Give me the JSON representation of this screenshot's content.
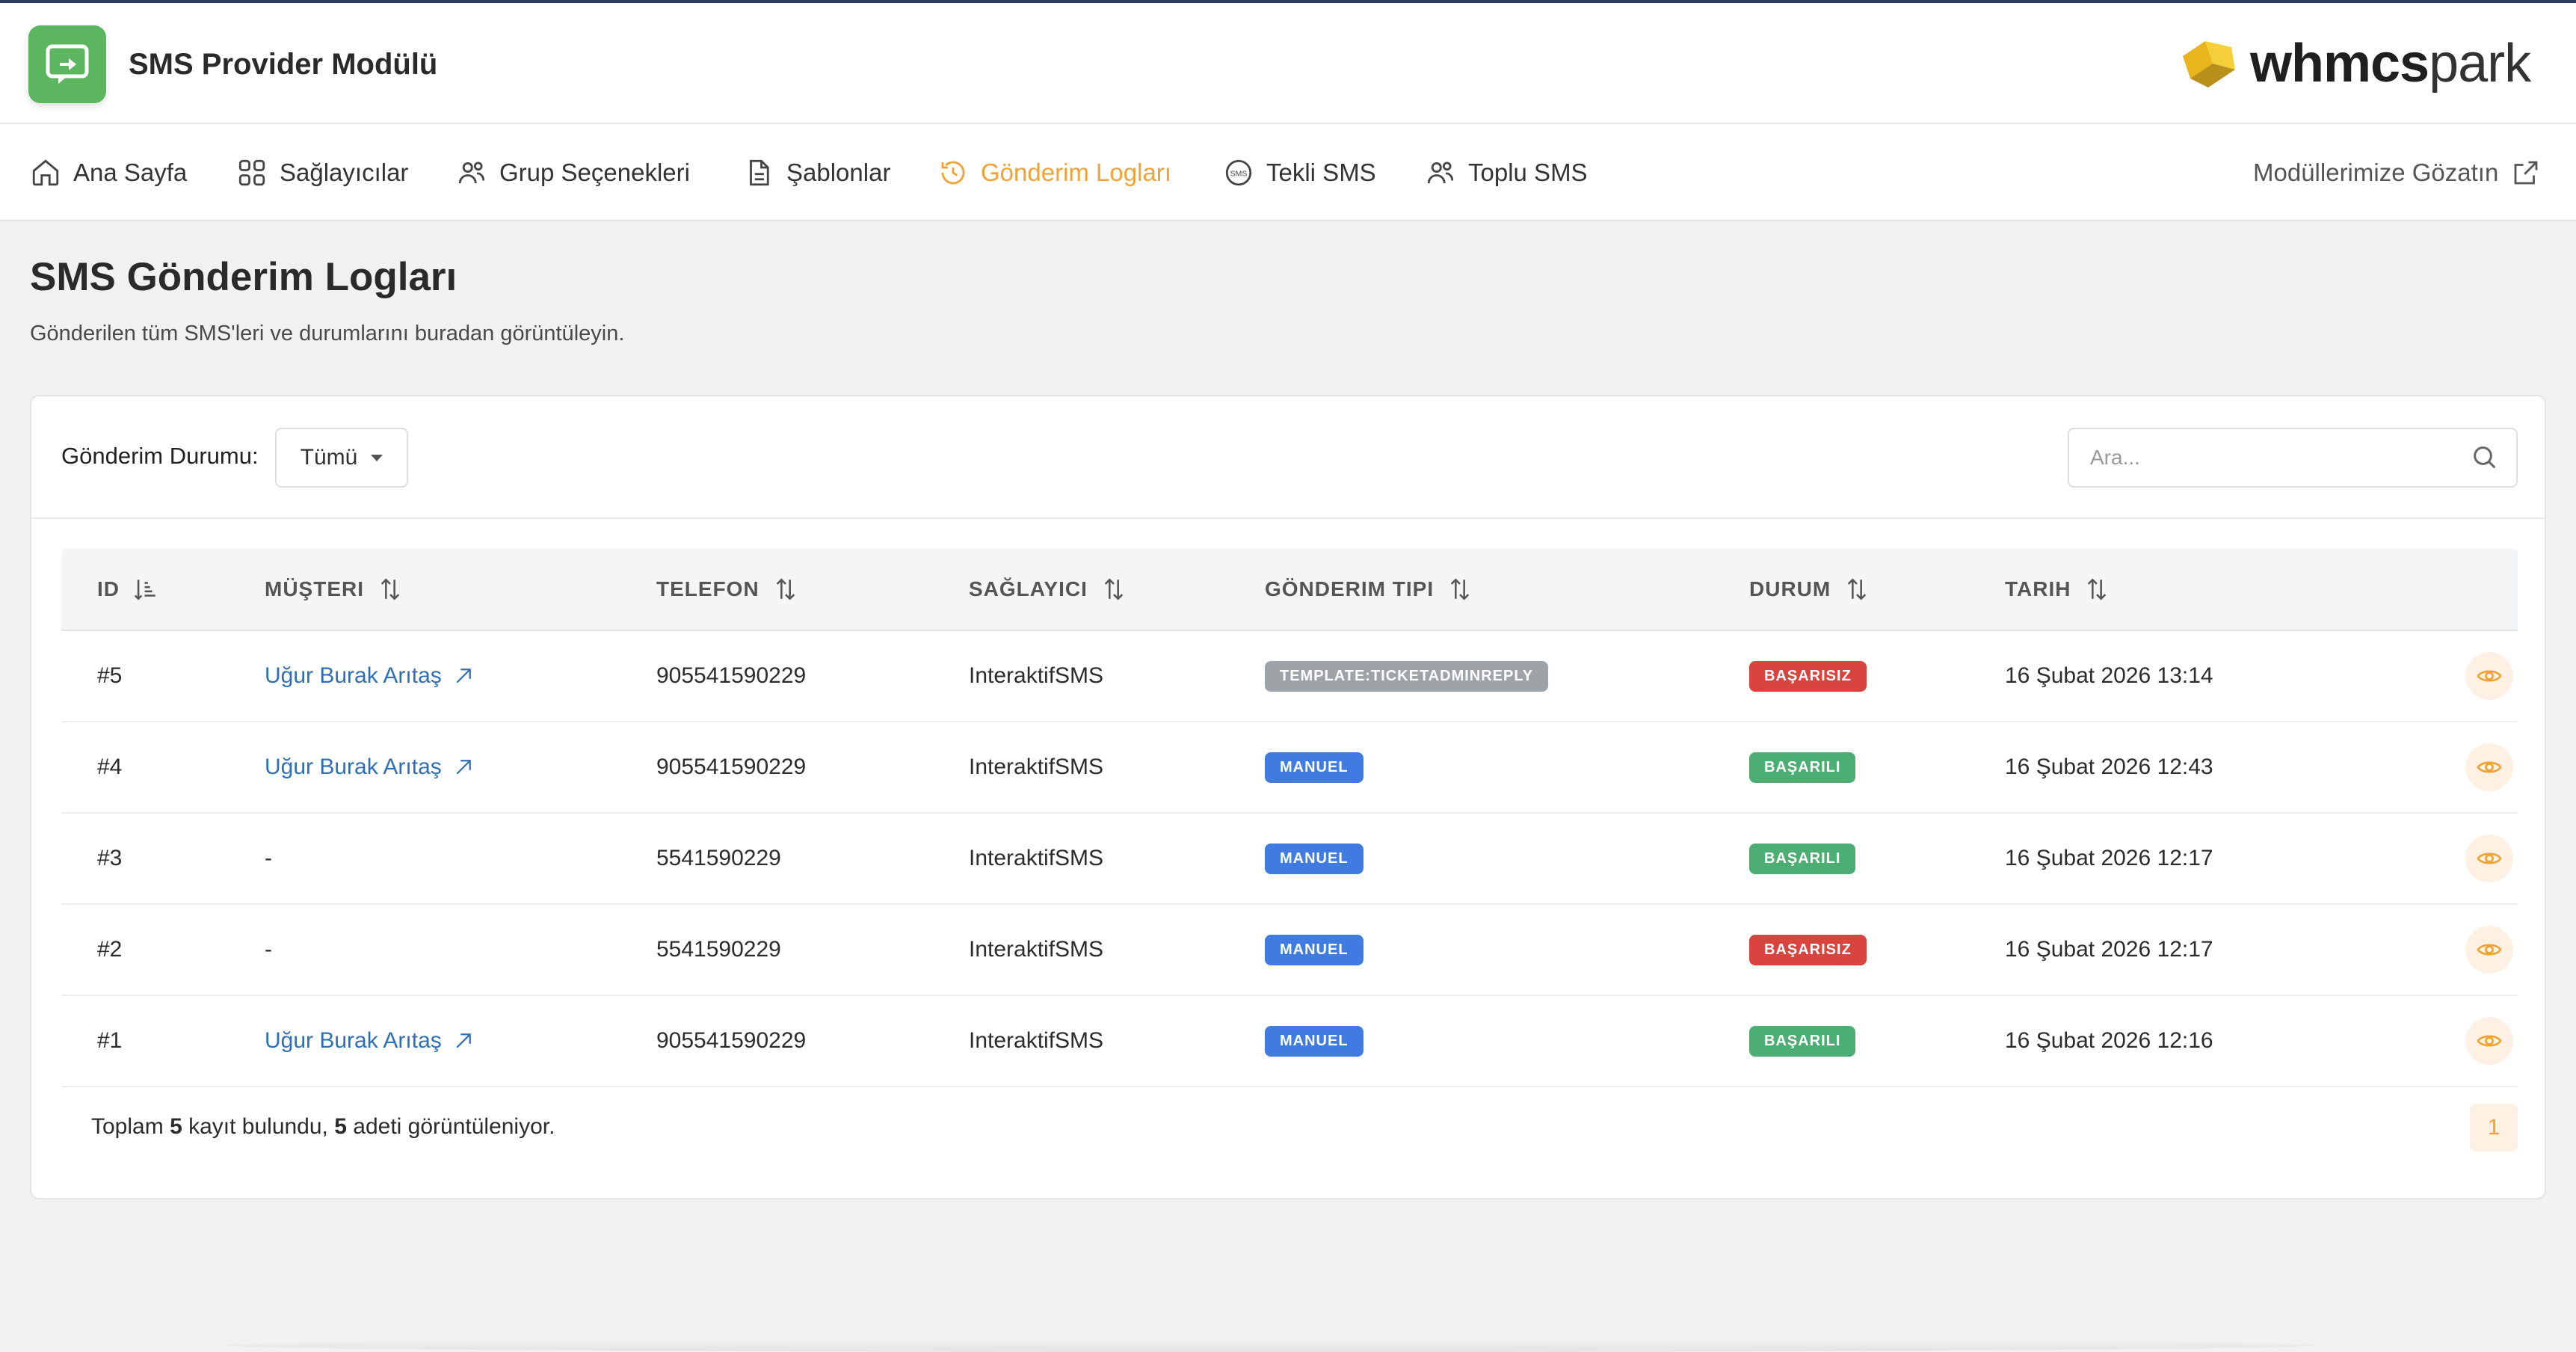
{
  "header": {
    "app_title": "SMS Provider Modülü",
    "brand_bold": "whmcs",
    "brand_light": "park"
  },
  "nav": {
    "items": [
      {
        "label": "Ana Sayfa",
        "icon": "home-icon"
      },
      {
        "label": "Sağlayıcılar",
        "icon": "grid-icon"
      },
      {
        "label": "Grup Seçenekleri",
        "icon": "users-icon"
      },
      {
        "label": "Şablonlar",
        "icon": "document-icon"
      },
      {
        "label": "Gönderim Logları",
        "icon": "history-icon",
        "active": true
      },
      {
        "label": "Tekli SMS",
        "icon": "sms-icon"
      },
      {
        "label": "Toplu SMS",
        "icon": "users-icon"
      }
    ],
    "right_label": "Modüllerimize Gözatın",
    "right_icon": "external-link-icon",
    "active_color": "#f0a233"
  },
  "page": {
    "title": "SMS Gönderim Logları",
    "subtitle": "Gönderilen tüm SMS'leri ve durumlarını buradan görüntüleyin."
  },
  "filter": {
    "label": "Gönderim Durumu:",
    "selected": "Tümü",
    "search_placeholder": "Ara..."
  },
  "table": {
    "columns": [
      "ID",
      "MÜŞTERI",
      "TELEFON",
      "SAĞLAYICI",
      "GÖNDERIM TIPI",
      "DURUM",
      "TARIH"
    ],
    "rows": [
      {
        "id": "#5",
        "customer": "Uğur Burak Arıtaş",
        "customer_link": true,
        "phone": "905541590229",
        "provider": "InteraktifSMS",
        "type": "TEMPLATE:TICKETADMINREPLY",
        "type_color": "gray",
        "status": "BAŞARISIZ",
        "status_color": "red",
        "date": "16 Şubat 2026 13:14"
      },
      {
        "id": "#4",
        "customer": "Uğur Burak Arıtaş",
        "customer_link": true,
        "phone": "905541590229",
        "provider": "InteraktifSMS",
        "type": "MANUEL",
        "type_color": "blue",
        "status": "BAŞARILI",
        "status_color": "green",
        "date": "16 Şubat 2026 12:43"
      },
      {
        "id": "#3",
        "customer": "-",
        "customer_link": false,
        "phone": "5541590229",
        "provider": "InteraktifSMS",
        "type": "MANUEL",
        "type_color": "blue",
        "status": "BAŞARILI",
        "status_color": "green",
        "date": "16 Şubat 2026 12:17"
      },
      {
        "id": "#2",
        "customer": "-",
        "customer_link": false,
        "phone": "5541590229",
        "provider": "InteraktifSMS",
        "type": "MANUEL",
        "type_color": "blue",
        "status": "BAŞARISIZ",
        "status_color": "red",
        "date": "16 Şubat 2026 12:17"
      },
      {
        "id": "#1",
        "customer": "Uğur Burak Arıtaş",
        "customer_link": true,
        "phone": "905541590229",
        "provider": "InteraktifSMS",
        "type": "MANUEL",
        "type_color": "blue",
        "status": "BAŞARILI",
        "status_color": "green",
        "date": "16 Şubat 2026 12:16"
      }
    ]
  },
  "footer": {
    "prefix": "Toplam",
    "total": "5",
    "middle": "kayıt bulundu,",
    "shown": "5",
    "suffix": "adeti görüntüleniyor.",
    "page": "1"
  },
  "colors": {
    "accent": "#f0a233",
    "link": "#2f6fb2",
    "success": "#4cae73",
    "danger": "#d9443f",
    "info": "#3f7be0",
    "neutral": "#9ea3a8"
  }
}
